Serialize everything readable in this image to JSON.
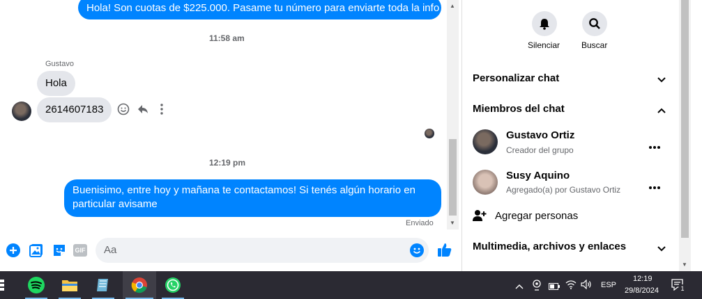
{
  "messages": {
    "out1": "Hola! Son cuotas de $225.000. Pasame tu número para enviarte toda la info",
    "time1": "11:58 am",
    "sender": "Gustavo",
    "in1": "Hola",
    "in2": "2614607183",
    "time2": "12:19 pm",
    "out2": "Buenisimo, entre hoy y mañana te contactamos! Si tenés algún horario en particular avisame",
    "status": "Enviado"
  },
  "composer": {
    "placeholder": "Aa",
    "gif_label": "GIF"
  },
  "side": {
    "mute_label": "Silenciar",
    "search_label": "Buscar",
    "customize": "Personalizar chat",
    "members_title": "Miembros del chat",
    "members": [
      {
        "name": "Gustavo Ortiz",
        "sub": "Creador del grupo"
      },
      {
        "name": "Susy Aquino",
        "sub": "Agregado(a) por Gustavo Ortiz"
      }
    ],
    "add_people": "Agregar personas",
    "media": "Multimedia, archivos y enlaces"
  },
  "taskbar": {
    "lang": "ESP",
    "time": "12:19",
    "date": "29/8/2024",
    "notif_count": "1"
  },
  "colors": {
    "accent": "#0084ff",
    "taskbar": "#2b2a33"
  }
}
